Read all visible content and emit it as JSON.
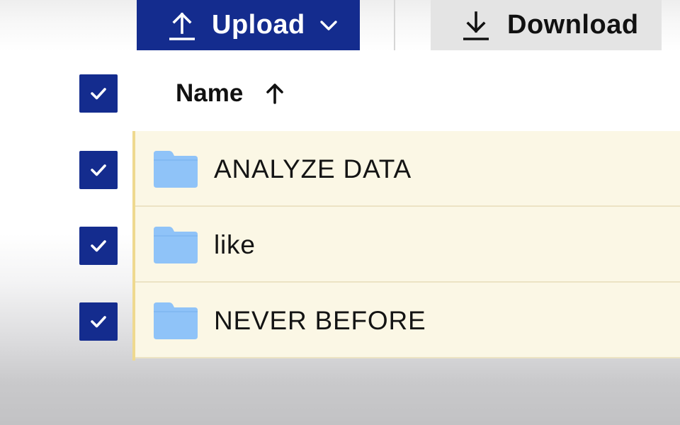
{
  "toolbar": {
    "upload_label": "Upload",
    "download_label": "Download",
    "upload_color": "#142c8e",
    "download_color": "#e4e4e4"
  },
  "table": {
    "header_checkbox_checked": true,
    "column_header": "Name",
    "sort_direction": "ascending",
    "rows": [
      {
        "name": "ANALYZE DATA",
        "type": "folder",
        "selected": true
      },
      {
        "name": "like",
        "type": "folder",
        "selected": true
      },
      {
        "name": "NEVER BEFORE",
        "type": "folder",
        "selected": true
      }
    ]
  },
  "colors": {
    "accent": "#142c8e",
    "selected_row_bg": "#fbf7e5",
    "selection_border": "#efd98f",
    "folder": "#8fc3f8"
  },
  "icons": {
    "upload": "upload-arrow-icon",
    "upload_menu": "chevron-down-icon",
    "download": "download-arrow-icon",
    "sort": "arrow-up-icon",
    "checkbox": "checkmark-icon",
    "row": "folder-icon"
  }
}
